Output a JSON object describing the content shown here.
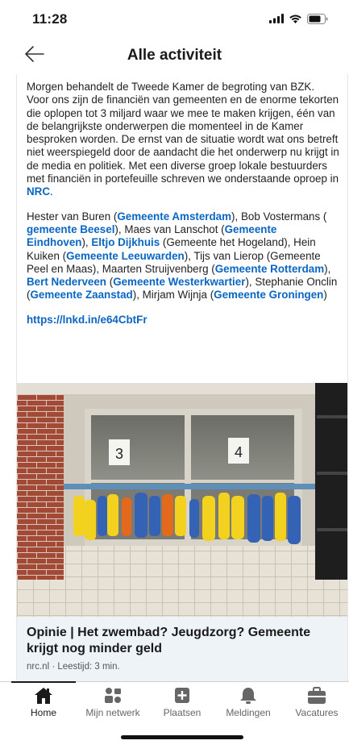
{
  "status": {
    "time": "11:28"
  },
  "header": {
    "title": "Alle activiteit"
  },
  "post": {
    "p1": [
      "Morgen behandelt de Tweede Kamer de begroting van BZK. Voor ons zijn de financiën van gemeenten en de enorme tekorten die oplopen tot 3 miljard waar we mee te maken krijgen, één van de belangrijkste onderwerpen die momenteel in de Kamer besproken worden. De ernst van de situatie wordt wat ons betreft niet weerspiegeld door de aandacht die het onderwerp nu krijgt in de media en politiek. Met een diverse groep lokale bestuurders met financiën in portefeuille schreven we onderstaande oproep in ",
      "NRC",
      "."
    ],
    "p2": [
      "Hester van Buren (",
      "Gemeente Amsterdam",
      "), Bob Vostermans ( ",
      "gemeente Beesel",
      "), Maes van Lanschot (",
      "Gemeente Eindhoven",
      "), ",
      "Eltjo Dijkhuis",
      " (Gemeente het Hogeland), Hein Kuiken (",
      "Gemeente Leeuwarden",
      "), Tijs van Lierop (Gemeente Peel en Maas), Maarten Struijvenberg (",
      "Gemeente Rotterdam",
      "), ",
      "Bert Nederveen",
      " (",
      "Gemeente Westerkwartier",
      "), Stephanie Onclin (",
      "Gemeente Zaanstad",
      "), Mirjam Wijnja (",
      "Gemeente Groningen",
      ")"
    ],
    "url": "https://lnkd.in/e64CbtFr"
  },
  "image": {
    "window_labels": [
      "3",
      "4"
    ]
  },
  "article": {
    "title": "Opinie | Het zwembad? Jeugdzorg? Gemeente krijgt nog minder geld",
    "source": "nrc.nl · Leestijd: 3 min."
  },
  "tabs": [
    {
      "label": "Home",
      "icon": "home-icon",
      "active": true
    },
    {
      "label": "Mijn netwerk",
      "icon": "network-icon",
      "active": false
    },
    {
      "label": "Plaatsen",
      "icon": "post-icon",
      "active": false
    },
    {
      "label": "Meldingen",
      "icon": "bell-icon",
      "active": false
    },
    {
      "label": "Vacatures",
      "icon": "briefcase-icon",
      "active": false
    }
  ],
  "colors": {
    "link": "#0a66c2",
    "article_bg": "#eef3f8"
  }
}
